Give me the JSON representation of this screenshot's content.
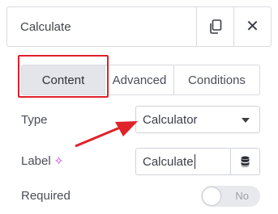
{
  "header": {
    "title": "Calculate",
    "copy_icon": "copy-icon",
    "close_icon": "close-icon"
  },
  "tabs": [
    {
      "label": "Content",
      "active": true
    },
    {
      "label": "Advanced",
      "active": false
    },
    {
      "label": "Conditions",
      "active": false
    }
  ],
  "fields": {
    "type": {
      "label": "Type",
      "value": "Calculator"
    },
    "label": {
      "label": "Label",
      "value": "Calculate",
      "icon": "sparkle-icon",
      "dynamic_icon": "database-icon"
    },
    "required": {
      "label": "Required",
      "toggle_text": "No",
      "on": false
    }
  },
  "colors": {
    "highlight": "#e0222a",
    "sparkle": "#c935d9"
  }
}
